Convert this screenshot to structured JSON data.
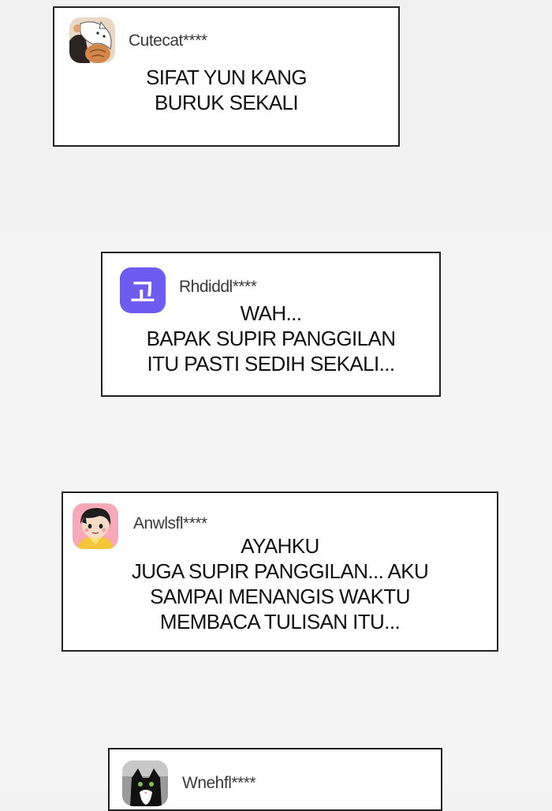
{
  "comments": [
    {
      "username": "Cutecat****",
      "avatar_icon": "cat-illustration-avatar-icon",
      "text": "SIFAT YUN KANG\nBURUK SEKALI"
    },
    {
      "username": "Rhdiddl****",
      "avatar_icon": "korean-letter-avatar-icon",
      "avatar_letter": "고",
      "avatar_color": "#6e5cf0",
      "text": "WAH...\nBAPAK SUPIR PANGGILAN\nITU PASTI SEDIH SEKALI..."
    },
    {
      "username": "Anwlsfl****",
      "avatar_icon": "boy-character-avatar-icon",
      "text": "AYAHKU\nJUGA SUPIR PANGGILAN... AKU\nSAMPAI MENANGIS WAKTU\nMEMBACA TULISAN ITU..."
    },
    {
      "username": "Wnehfl****",
      "avatar_icon": "black-cat-avatar-icon"
    }
  ]
}
